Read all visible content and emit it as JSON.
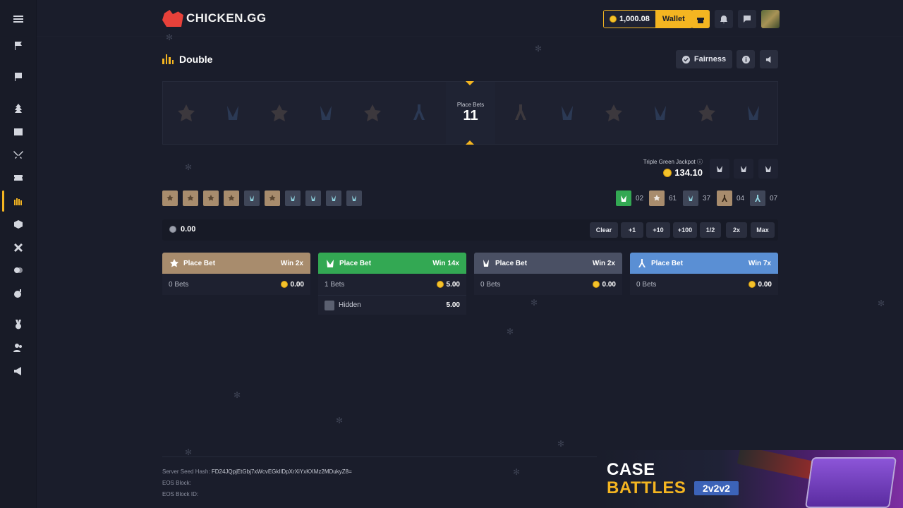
{
  "header": {
    "logo": "CHICKEN.GG",
    "balance": "1,000.08",
    "wallet_label": "Wallet"
  },
  "sidebar": {
    "items": [
      {
        "icon": "menu-icon"
      },
      {
        "icon": "flag-icon"
      },
      {
        "icon": "flag-outline-icon"
      },
      {
        "icon": "tree-icon"
      },
      {
        "icon": "inbox-icon"
      },
      {
        "icon": "swords-icon"
      },
      {
        "icon": "ticket-icon"
      },
      {
        "icon": "double-icon",
        "active": true
      },
      {
        "icon": "cube-icon"
      },
      {
        "icon": "cross-icon"
      },
      {
        "icon": "coin-flip-icon"
      },
      {
        "icon": "bomb-icon"
      },
      {
        "icon": "medal-icon"
      },
      {
        "icon": "users-icon"
      },
      {
        "icon": "megaphone-icon"
      }
    ]
  },
  "game": {
    "title": "Double",
    "fairness_label": "Fairness",
    "roller": {
      "label": "Place Bets",
      "countdown": "11"
    },
    "jackpot": {
      "label": "Triple Green Jackpot",
      "value": "134.10"
    },
    "history": [
      "t",
      "t",
      "t",
      "t",
      "ct",
      "t",
      "ct",
      "ct",
      "ct",
      "ct"
    ],
    "stats": [
      {
        "type": "green",
        "value": "02"
      },
      {
        "type": "t",
        "value": "61"
      },
      {
        "type": "ct",
        "value": "37"
      },
      {
        "type": "t-bonus",
        "value": "04"
      },
      {
        "type": "ct-bonus",
        "value": "07"
      }
    ],
    "bet_input": {
      "value": "0.00",
      "buttons": [
        "Clear",
        "+1",
        "+10",
        "+100",
        "1/2",
        "2x",
        "Max"
      ]
    },
    "columns": [
      {
        "label": "Place Bet",
        "win": "Win 2x",
        "color": "#a88c6d",
        "bets": "0 Bets",
        "total": "0.00",
        "players": []
      },
      {
        "label": "Place Bet",
        "win": "Win 14x",
        "color": "#33a853",
        "bets": "1 Bets",
        "total": "5.00",
        "players": [
          {
            "name": "Hidden",
            "amount": "5.00"
          }
        ]
      },
      {
        "label": "Place Bet",
        "win": "Win 2x",
        "color": "#4a5064",
        "bets": "0 Bets",
        "total": "0.00",
        "players": []
      },
      {
        "label": "Place Bet",
        "win": "Win 7x",
        "color": "#5a8fd4",
        "bets": "0 Bets",
        "total": "0.00",
        "players": []
      }
    ]
  },
  "footer": {
    "server_seed_label": "Server Seed Hash:",
    "server_seed_value": "FD24JQpjEtGbj7xWcvEGkIlDpXrXiYxKXMz2MDukyZ8=",
    "eos_block_label": "EOS Block:",
    "eos_block_id_label": "EOS Block ID:"
  },
  "banner": {
    "line1": "CASE",
    "line2": "BATTLES",
    "tag": "2v2v2"
  },
  "colors": {
    "accent": "#f4b521",
    "background": "#1a1d2b"
  }
}
